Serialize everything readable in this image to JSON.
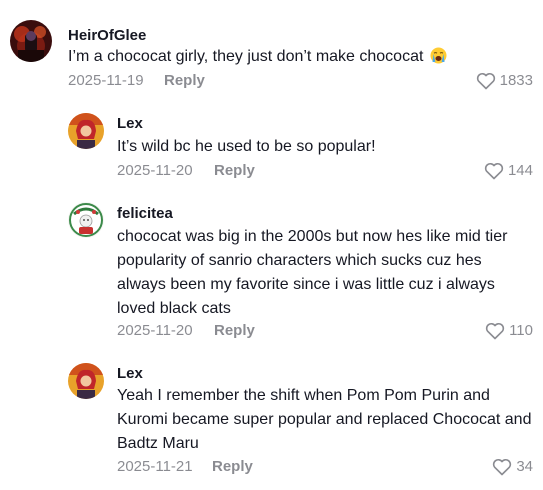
{
  "comments": [
    {
      "username": "HeirOfGlee",
      "text": "I’m a chococat girly, they just don’t make chococat",
      "emoji_icon": "loudly-crying-face-icon",
      "date": "2025-11-19",
      "reply_label": "Reply",
      "likes": "1833"
    },
    {
      "username": "Lex",
      "text": "It’s wild bc he used to be so popular!",
      "date": "2025-11-20",
      "reply_label": "Reply",
      "likes": "144"
    },
    {
      "username": "felicitea",
      "lines": [
        "chococat was big in the 2000s but now hes like mid tier",
        "popularity of sanrio characters which sucks cuz hes",
        "always been my favorite since i was little cuz i always",
        "loved black cats"
      ],
      "date": "2025-11-20",
      "reply_label": "Reply",
      "likes": "110"
    },
    {
      "username": "Lex",
      "lines": [
        "Yeah I remember the shift when Pom Pom Purin and",
        "Kuromi became super popular and replaced Chococat and",
        "Badtz Maru"
      ],
      "date": "2025-11-21",
      "reply_label": "Reply",
      "likes": "34"
    }
  ],
  "colors": {
    "text": "#161823",
    "meta": "rgba(22,24,35,0.5)",
    "background": "#ffffff"
  },
  "icons": {
    "like": "heart-outline-icon"
  }
}
